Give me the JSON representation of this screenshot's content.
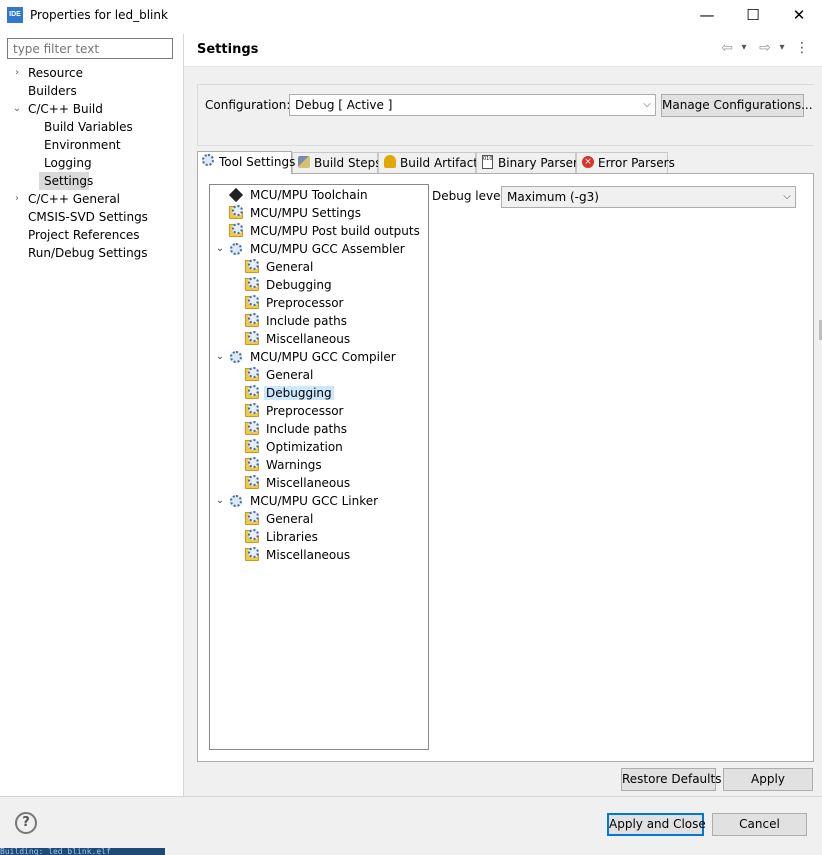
{
  "window": {
    "app_icon_text": "IDE",
    "title": "Properties for led_blink",
    "min_glyph": "—",
    "max_glyph": "☐",
    "close_glyph": "✕"
  },
  "filter": {
    "placeholder": "type filter text"
  },
  "nav": {
    "items": [
      {
        "label": "Resource",
        "chevron": "›"
      },
      {
        "label": "Builders"
      },
      {
        "label": "C/C++ Build",
        "chevron": "⌄"
      },
      {
        "label": "Build Variables"
      },
      {
        "label": "Environment"
      },
      {
        "label": "Logging"
      },
      {
        "label": "Settings"
      },
      {
        "label": "C/C++ General",
        "chevron": "›"
      },
      {
        "label": "CMSIS-SVD Settings"
      },
      {
        "label": "Project References"
      },
      {
        "label": "Run/Debug Settings"
      }
    ]
  },
  "header": {
    "title": "Settings",
    "back_icon": "⇦",
    "forward_icon": "⇨",
    "dropdown_icon": "▾",
    "menu_icon": "⋮"
  },
  "config": {
    "label": "Configuration:",
    "value": "Debug  [ Active ]",
    "manage_label": "Manage Configurations..."
  },
  "tabs": [
    {
      "label": "Tool Settings",
      "icon": "tool-settings-icon",
      "active": true
    },
    {
      "label": "Build Steps",
      "icon": "build-steps-icon"
    },
    {
      "label": "Build Artifact",
      "icon": "build-artifact-icon"
    },
    {
      "label": "Binary Parsers",
      "icon": "binary-parsers-icon"
    },
    {
      "label": "Error Parsers",
      "icon": "error-parsers-icon"
    }
  ],
  "tree": [
    {
      "label": "MCU/MPU Toolchain",
      "icon": "chip-icon"
    },
    {
      "label": "MCU/MPU Settings",
      "icon": "settings-folder-icon"
    },
    {
      "label": "MCU/MPU Post build outputs",
      "icon": "settings-folder-icon"
    },
    {
      "label": "MCU/MPU GCC Assembler",
      "icon": "gear-icon",
      "expanded": true
    },
    {
      "label": "General",
      "icon": "settings-folder-icon"
    },
    {
      "label": "Debugging",
      "icon": "settings-folder-icon"
    },
    {
      "label": "Preprocessor",
      "icon": "settings-folder-icon"
    },
    {
      "label": "Include paths",
      "icon": "settings-folder-icon"
    },
    {
      "label": "Miscellaneous",
      "icon": "settings-folder-icon"
    },
    {
      "label": "MCU/MPU GCC Compiler",
      "icon": "gear-icon",
      "expanded": true
    },
    {
      "label": "General",
      "icon": "settings-folder-icon"
    },
    {
      "label": "Debugging",
      "icon": "settings-folder-icon",
      "selected": true
    },
    {
      "label": "Preprocessor",
      "icon": "settings-folder-icon"
    },
    {
      "label": "Include paths",
      "icon": "settings-folder-icon"
    },
    {
      "label": "Optimization",
      "icon": "settings-folder-icon"
    },
    {
      "label": "Warnings",
      "icon": "settings-folder-icon"
    },
    {
      "label": "Miscellaneous",
      "icon": "settings-folder-icon"
    },
    {
      "label": "MCU/MPU GCC Linker",
      "icon": "gear-icon",
      "expanded": true
    },
    {
      "label": "General",
      "icon": "settings-folder-icon"
    },
    {
      "label": "Libraries",
      "icon": "settings-folder-icon"
    },
    {
      "label": "Miscellaneous",
      "icon": "settings-folder-icon"
    }
  ],
  "debug": {
    "label": "Debug level",
    "value": "Maximum (-g3)"
  },
  "buttons": {
    "restore": "Restore Defaults",
    "apply": "Apply",
    "apply_close": "Apply and Close",
    "cancel": "Cancel",
    "help": "?"
  },
  "status_strip": "Building: led_blink.elf",
  "colors": {
    "accent": "#0078d7",
    "selection": "#cce8ff",
    "nav_selection": "#d9d9d9"
  }
}
